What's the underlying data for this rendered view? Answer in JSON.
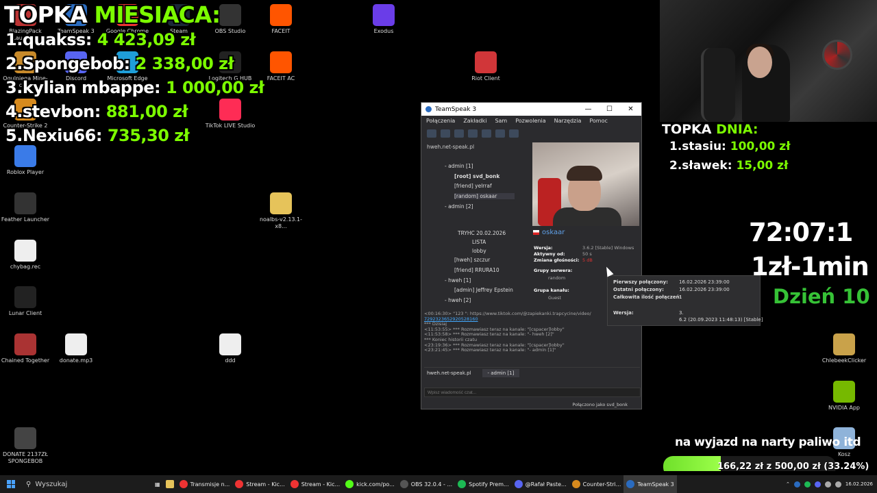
{
  "overlay": {
    "topka_title_white": "TOPKA ",
    "topka_title_green": "MIESIACA:",
    "ranks": [
      {
        "name": "1.quakss: ",
        "amount": "4 423,09 zł"
      },
      {
        "name": "2.Spongebob: ",
        "amount": "2 338,00 zł"
      },
      {
        "name": "3.kylian mbappe: ",
        "amount": "1 000,00 zł"
      },
      {
        "name": "4.stevbon: ",
        "amount": "881,00 zł"
      },
      {
        "name": "5.Nexiu66: ",
        "amount": "735,30 zł"
      }
    ],
    "day_title_white": "TOPKA ",
    "day_title_green": "DNIA:",
    "day_ranks": [
      {
        "name": "1.stasiu: ",
        "amount": "100,00 zł"
      },
      {
        "name": "2.sławek: ",
        "amount": "15,00 zł"
      }
    ],
    "timer": "72:07:1",
    "rate": "1zł-1min",
    "day_counter": "Dzień 10",
    "goal_text": "na wyjazd na narty paliwo itd",
    "goal_label": "166,22 zł z 500,00 zł (33.24%)",
    "goal_fraction": 0.3324
  },
  "desktop_icons": [
    {
      "label": "BlazingPack Launcher",
      "icon": "blazingpack-icon",
      "color": "#b33"
    },
    {
      "label": "TeamSpeak 3 Client",
      "icon": "teamspeak-icon",
      "color": "#2a6bbf"
    },
    {
      "label": "Google Chrome",
      "icon": "chrome-icon",
      "color": "#e33"
    },
    {
      "label": "Steam",
      "icon": "steam-icon",
      "color": "#1b2838"
    },
    {
      "label": "OBS Studio",
      "icon": "obs-icon",
      "color": "#333"
    },
    {
      "label": "FACEIT",
      "icon": "faceit-icon",
      "color": "#f50"
    },
    {
      "label": "Exodus",
      "icon": "exodus-icon",
      "color": "#6a3de8"
    },
    {
      "label": "Ogulniega Mine-craft",
      "icon": "minecraft-icon",
      "color": "#c88a2a"
    },
    {
      "label": "Discord",
      "icon": "discord-icon",
      "color": "#5865f2"
    },
    {
      "label": "Microsoft Edge",
      "icon": "edge-icon",
      "color": "#1f9ed8"
    },
    {
      "label": "Logitech G HUB",
      "icon": "ghub-icon",
      "color": "#222"
    },
    {
      "label": "FACEIT AC",
      "icon": "faceit-ac-icon",
      "color": "#f50"
    },
    {
      "label": "Riot Client",
      "icon": "riot-icon",
      "color": "#d13639"
    },
    {
      "label": "Counter-Strike 2",
      "icon": "cs2-icon",
      "color": "#d68a1e"
    },
    {
      "label": "TikTok LIVE Studio",
      "icon": "tiktok-icon",
      "color": "#fe2c55"
    },
    {
      "label": "Roblox Player",
      "icon": "roblox-icon",
      "color": "#3a7be8"
    },
    {
      "label": "Feather Launcher",
      "icon": "feather-icon",
      "color": "#333"
    },
    {
      "label": "noalbs-v2.13.1-x8...",
      "icon": "folder-icon",
      "color": "#e6c35a"
    },
    {
      "label": "chybag.rec",
      "icon": "file-icon",
      "color": "#eee"
    },
    {
      "label": "Lunar Client",
      "icon": "lunar-icon",
      "color": "#222"
    },
    {
      "label": "Chained Together",
      "icon": "chained-icon",
      "color": "#a33"
    },
    {
      "label": "donate.mp3",
      "icon": "audio-file-icon",
      "color": "#eee"
    },
    {
      "label": "ddd",
      "icon": "file-icon",
      "color": "#eee"
    },
    {
      "label": "ChlebeekClicker",
      "icon": "clicker-icon",
      "color": "#c9a24a"
    },
    {
      "label": "NVIDIA App",
      "icon": "nvidia-icon",
      "color": "#76b900"
    },
    {
      "label": "Kosz",
      "icon": "recycle-bin-icon",
      "color": "#8fb3d9"
    },
    {
      "label": "DONATE 2137ZŁ SPONGEBOB",
      "icon": "video-file-icon",
      "color": "#444"
    }
  ],
  "ts": {
    "title": "TeamSpeak 3",
    "menu": [
      "Połączenia",
      "Zakładki",
      "Sam",
      "Pozwolenia",
      "Narzędzia",
      "Pomoc"
    ],
    "server": "hweh.net-speak.pl",
    "tree": [
      "- admin [1]",
      "[root] svd_bonk",
      "[friend] yelrraf",
      "[random] oskaar",
      "- admin [2]",
      "TRYHC 20.02.2026",
      "LISTA",
      "lobby",
      "[hweh] szczur",
      "[friend] RRURA10",
      "- hweh [1]",
      "[admin] Jeffrey Epstein",
      "- hweh [2]"
    ],
    "client_name": "oskaar",
    "info": {
      "version_label": "Wersja:",
      "version_value": "3.6.2 [Stable] Windows",
      "active_label": "Aktywny od:",
      "active_value": "50 s",
      "volume_label": "Zmiana głośności:",
      "volume_value": "5 dB",
      "server_groups_label": "Grupy serwera:",
      "server_groups_value": "random",
      "channel_group_label": "Grupa kanału:",
      "channel_group_value": "Guest"
    },
    "chat": [
      {
        "text": "<00:16:30> \"123 \": https://www.tiktok.com/@zapiekanki.trapcycine/video/",
        "color": ""
      },
      {
        "text": "7292323652920528160",
        "color": "link"
      },
      {
        "text": "*** Dzisiaj",
        "color": ""
      },
      {
        "text": "<11:53:55> *** Rozmawiasz teraz na kanale: \"[cspacer]lobby\"",
        "color": ""
      },
      {
        "text": "<11:53:58> *** Rozmawiasz teraz na kanale: \"- hweh [2]\"",
        "color": ""
      },
      {
        "text": "*** Koniec historii czatu",
        "color": ""
      },
      {
        "text": "<23:19:36> *** Rozmawiasz teraz na kanale: \"[cspacer]lobby\"",
        "color": ""
      },
      {
        "text": "<23:21:45> *** Rozmawiasz teraz na kanale: \"- admin [1]\"",
        "color": ""
      }
    ],
    "tab_server": "hweh.net-speak.pl",
    "tab_channel": "- admin [1]",
    "message_placeholder": "Wpisz wiadomość czat...",
    "status": "Połączono jako svd_bonk"
  },
  "tooltip": {
    "first_label": "Pierwszy połączony:",
    "first_value": "16.02.2026 23:39:00",
    "last_label": "Ostatni połączony:",
    "last_value": "16.02.2026 23:39:00",
    "total_label": "Całkowita ilość połączeń:",
    "total_value": "1",
    "version_label": "Wersja:",
    "version_value_1": "3.",
    "version_value_2": "6.2 (20.09.2023 11:48:13) [Stable]"
  },
  "taskbar": {
    "search_placeholder": "Wyszukaj",
    "apps": [
      {
        "label": "Transmisje n...",
        "icon": "chrome-icon",
        "color": "#e33"
      },
      {
        "label": "Stream - Kic...",
        "icon": "chrome-icon",
        "color": "#e33"
      },
      {
        "label": "Stream - Kic...",
        "icon": "chrome-icon",
        "color": "#e33"
      },
      {
        "label": "kick.com/po...",
        "icon": "kick-icon",
        "color": "#53fc18"
      },
      {
        "label": "OBS 32.0.4 - ...",
        "icon": "obs-icon",
        "color": "#555"
      },
      {
        "label": "Spotify Prem...",
        "icon": "spotify-icon",
        "color": "#1db954"
      },
      {
        "label": "@Rafał Paste...",
        "icon": "discord-icon",
        "color": "#5865f2"
      },
      {
        "label": "Counter-Stri...",
        "icon": "cs2-icon",
        "color": "#d68a1e"
      },
      {
        "label": "TeamSpeak 3",
        "icon": "teamspeak-icon",
        "color": "#2a6bbf"
      }
    ],
    "date": "16.02.2026"
  }
}
